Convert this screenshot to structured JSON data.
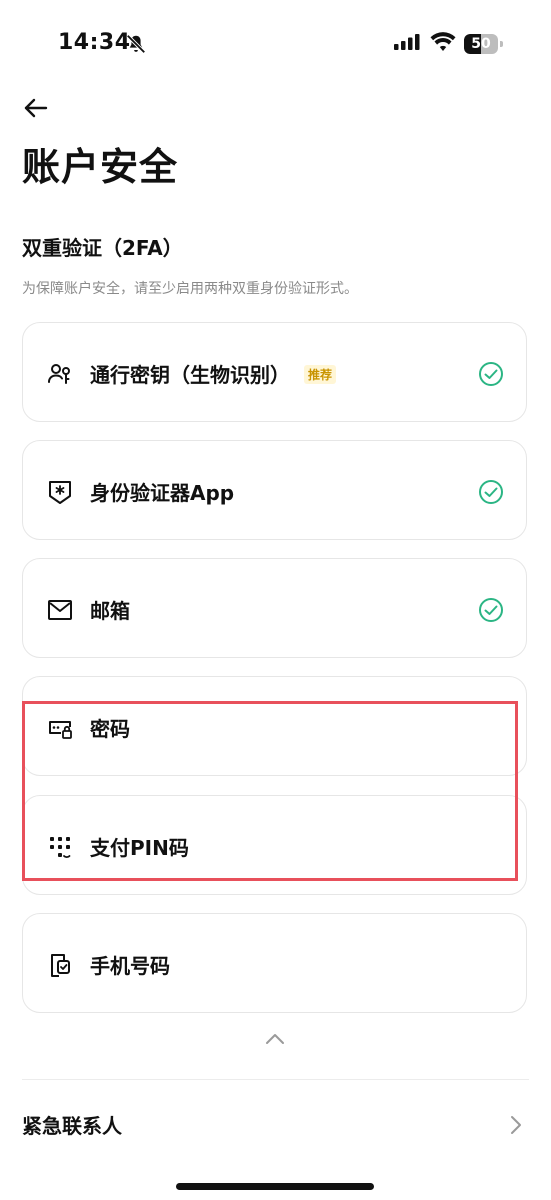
{
  "status_bar": {
    "time": "14:34",
    "battery": "50",
    "battery_level": 0.5
  },
  "header": {
    "title": "账户安全"
  },
  "two_fa": {
    "title": "双重验证（2FA）",
    "description": "为保障账户安全，请至少启用两种双重身份验证形式。",
    "items": [
      {
        "label": "通行密钥（生物识别）",
        "badge": "推荐",
        "icon": "passkey-icon",
        "enabled": true
      },
      {
        "label": "身份验证器App",
        "icon": "authenticator-icon",
        "enabled": true
      },
      {
        "label": "邮箱",
        "icon": "mail-icon",
        "enabled": true
      },
      {
        "label": "密码",
        "icon": "password-icon",
        "enabled": false
      },
      {
        "label": "支付PIN码",
        "icon": "pin-keypad-icon",
        "enabled": false
      },
      {
        "label": "手机号码",
        "icon": "phone-icon",
        "enabled": false
      }
    ]
  },
  "emergency": {
    "label": "紧急联系人"
  },
  "colors": {
    "check": "#2bb584",
    "highlight": "#e8505b",
    "badge_bg": "#fff6d6",
    "badge_text": "#c99400"
  }
}
